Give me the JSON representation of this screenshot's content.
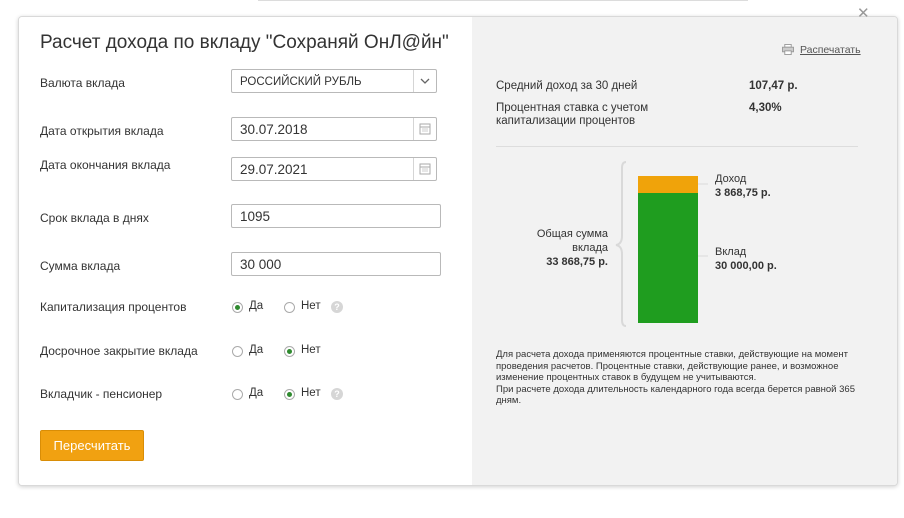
{
  "form": {
    "title": "Расчет дохода по вкладу \"Сохраняй ОнЛ@йн\"",
    "currency": {
      "label": "Валюта вклада",
      "value": "РОССИЙСКИЙ РУБЛЬ"
    },
    "open_date": {
      "label": "Дата открытия вклада",
      "value": "30.07.2018"
    },
    "close_date": {
      "label": "Дата окончания вклада",
      "value": "29.07.2021"
    },
    "term": {
      "label": "Срок вклада в днях",
      "value": "1095"
    },
    "amount": {
      "label": "Сумма вклада",
      "value": "30 000"
    },
    "capitalization": {
      "label": "Капитализация процентов",
      "yes": "Да",
      "no": "Нет",
      "selected": "yes"
    },
    "early_close": {
      "label": "Досрочное закрытие вклада",
      "yes": "Да",
      "no": "Нет",
      "selected": "no"
    },
    "pensioner": {
      "label": "Вкладчик - пенсионер",
      "yes": "Да",
      "no": "Нет",
      "selected": "no"
    },
    "recalc_button": "Пересчитать"
  },
  "summary": {
    "print_link": "Распечатать",
    "avg_income_label": "Средний доход за 30 дней",
    "avg_income_value": "107,47 р.",
    "rate_label_line1": "Процентная ставка с учетом",
    "rate_label_line2": "капитализации процентов",
    "rate_value": "4,30%"
  },
  "chart_data": {
    "type": "bar",
    "total_label": "Общая сумма вклада",
    "total_value": "33 868,75 р.",
    "series": [
      {
        "name": "Доход",
        "label": "3 868,75 р.",
        "value": 3868.75,
        "color": "#f0a30a"
      },
      {
        "name": "Вклад",
        "label": "30 000,00 р.",
        "value": 30000.0,
        "color": "#1f9d1f"
      }
    ]
  },
  "note": {
    "line1": "Для расчета дохода применяются процентные ставки, действующие на момент проведения расчетов. Процентные ставки, действующие ранее, и возможное изменение процентных ставок в будущем не учитываются.",
    "line2": "При расчете дохода длительность календарного года всегда берется равной 365 дням."
  }
}
